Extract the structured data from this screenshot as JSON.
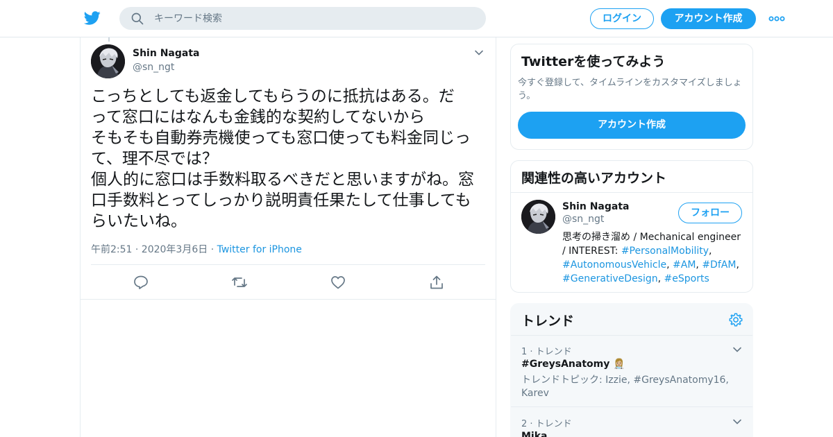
{
  "header": {
    "logo_icon": "twitter-bird-icon",
    "search_placeholder": "キーワード検索",
    "login_label": "ログイン",
    "signup_label": "アカウント作成",
    "more_icon": "more-dots-icon",
    "brand_color": "#1da1f2"
  },
  "tweet": {
    "author_name": "Shin Nagata",
    "author_handle": "@sn_ngt",
    "text_lines": [
      "こっちとしても返金してもらうのに抵抗はある。だ",
      "って窓口にはなんも金銭的な契約してないから",
      "そもそも自動券売機使っても窓口使っても料金同じっ",
      "て、理不尽では？",
      "個人的に窓口は手数料取るべきだと思いますがね。窓",
      "口手数料とってしっかり説明責任果たして仕事しても",
      "らいたいね。"
    ],
    "timestamp": "午前2:51 · 2020年3月6日",
    "separator": "·",
    "source": "Twitter for iPhone",
    "actions": [
      "reply-icon",
      "retweet-icon",
      "like-icon",
      "share-icon"
    ]
  },
  "signup_card": {
    "title": "Twitterを使ってみよう",
    "description": "今すぐ登録して、タイムラインをカスタマイズしましょう。",
    "button_label": "アカウント作成"
  },
  "related_card": {
    "title": "関連性の高いアカウント",
    "account": {
      "name": "Shin Nagata",
      "handle": "@sn_ngt",
      "follow_label": "フォロー",
      "bio_line1": "思考の掃き溜め / Mechanical engineer",
      "bio_interest_prefix": "/ INTEREST: ",
      "hashtags": [
        "#PersonalMobility",
        "#AutonomousVehicle",
        "#AM",
        "#DfAM",
        "#GenerativeDesign",
        "#eSports"
      ]
    }
  },
  "trends_card": {
    "title": "トレンド",
    "settings_icon": "gear-icon",
    "items": [
      {
        "meta": "1 · トレンド",
        "name": "#GreysAnatomy",
        "emoji": "👩🏼‍⚕️",
        "context": "トレンドトピック: Izzie, #GreysAnatomy16, Karev"
      },
      {
        "meta": "2 · トレンド",
        "name": "Mika",
        "emoji": "",
        "context": ""
      }
    ]
  }
}
